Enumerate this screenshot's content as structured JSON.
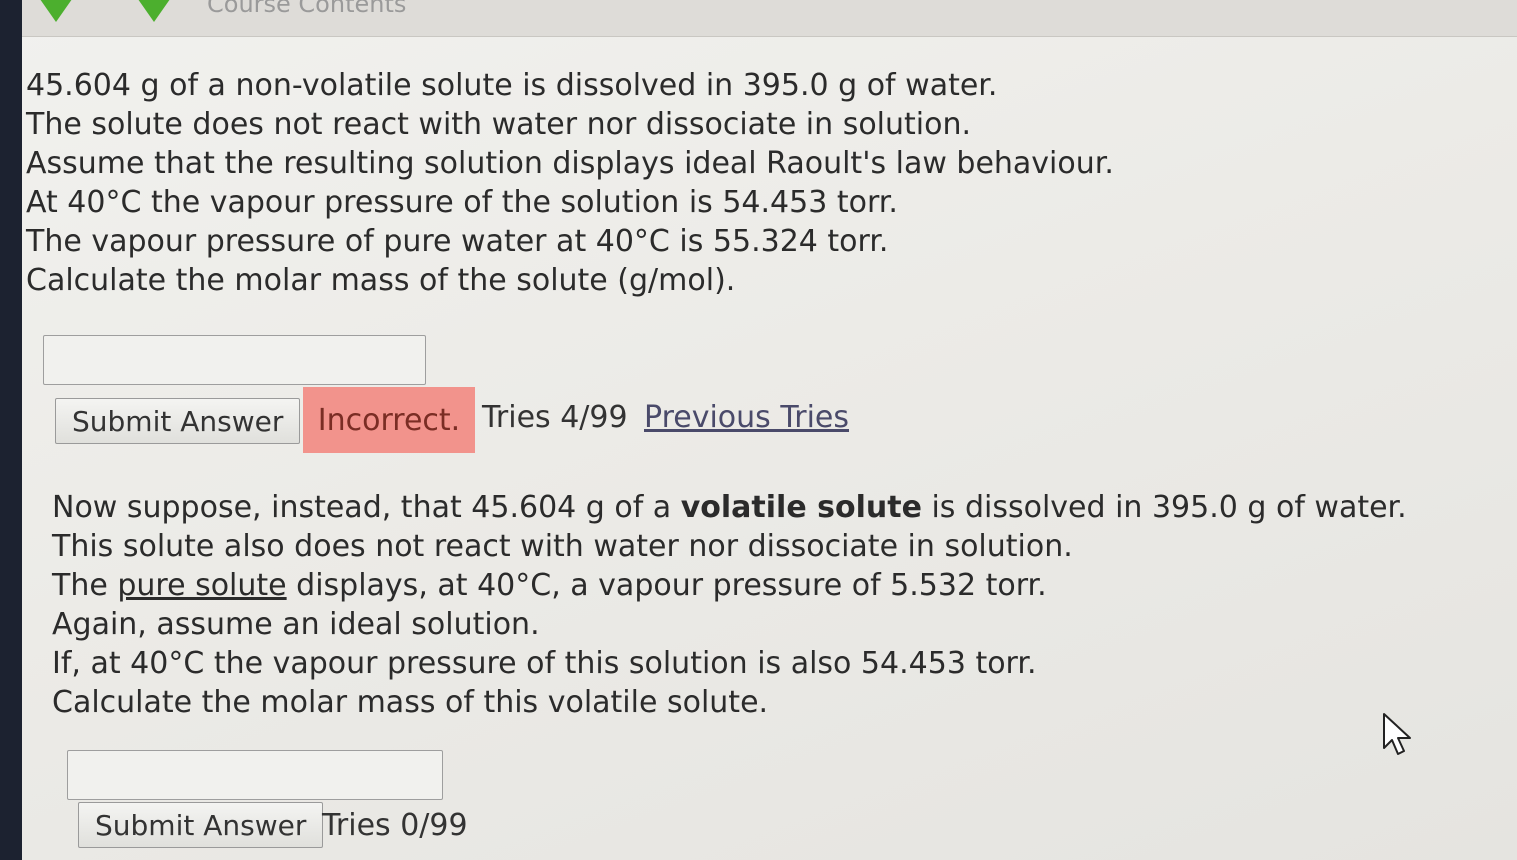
{
  "header": {
    "course_title": "Course Contents"
  },
  "part1": {
    "lines": [
      "45.604 g of a non-volatile solute is dissolved in 395.0 g of water.",
      "The solute does not react with water nor dissociate in solution.",
      "Assume that the resulting solution displays ideal Raoult's law behaviour.",
      "At 40°C the vapour pressure of the solution is 54.453 torr.",
      "The vapour pressure of pure water at 40°C is 55.324 torr.",
      "Calculate the molar mass of the solute (g/mol)."
    ],
    "answer_value": "",
    "submit_label": "Submit Answer",
    "status": "Incorrect.",
    "tries": "Tries 4/99",
    "previous_tries_label": "Previous Tries"
  },
  "part2": {
    "line1": {
      "before": "Now suppose, instead, that 45.604 g of a ",
      "bold": "volatile solute",
      "after": " is dissolved in 395.0 g of water."
    },
    "line2": "This solute also does not react with water nor dissociate in solution.",
    "line3": {
      "before": "The ",
      "underlined": "pure solute",
      "after": " displays, at 40°C, a vapour pressure of 5.532 torr."
    },
    "line4": "Again, assume an ideal solution.",
    "line5": "If, at 40°C the vapour pressure of this solution is also 54.453 torr.",
    "line6": "Calculate the molar mass of this volatile solute.",
    "answer_value": "",
    "submit_label": "Submit Answer",
    "tries": "Tries 0/99"
  },
  "colors": {
    "incorrect_bg": "#f2938c",
    "nav_arrow": "#4caf2e"
  }
}
